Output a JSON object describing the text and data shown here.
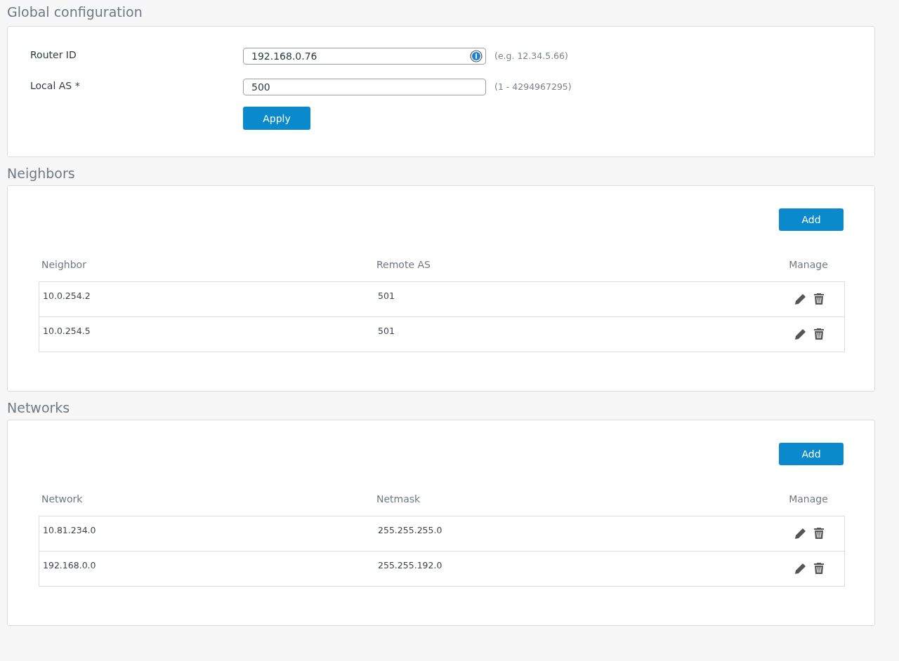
{
  "global": {
    "title": "Global configuration",
    "fields": [
      {
        "label": "Router ID",
        "value": "192.168.0.76",
        "hint": "(e.g. 12.34.5.66)",
        "icon": true
      },
      {
        "label": "Local AS *",
        "value": "500",
        "hint": "(1 - 4294967295)",
        "icon": false
      }
    ],
    "button": "Apply"
  },
  "tables": [
    {
      "title": "Neighbors",
      "add": "Add",
      "columns": [
        "Neighbor",
        "Remote AS",
        "Manage"
      ],
      "rows": [
        [
          "10.0.254.2",
          "501"
        ],
        [
          "10.0.254.5",
          "501"
        ]
      ]
    },
    {
      "title": "Networks",
      "add": "Add",
      "columns": [
        "Network",
        "Netmask",
        "Manage"
      ],
      "rows": [
        [
          "10.81.234.0",
          "255.255.255.0"
        ],
        [
          "192.168.0.0",
          "255.255.192.0"
        ]
      ]
    }
  ]
}
